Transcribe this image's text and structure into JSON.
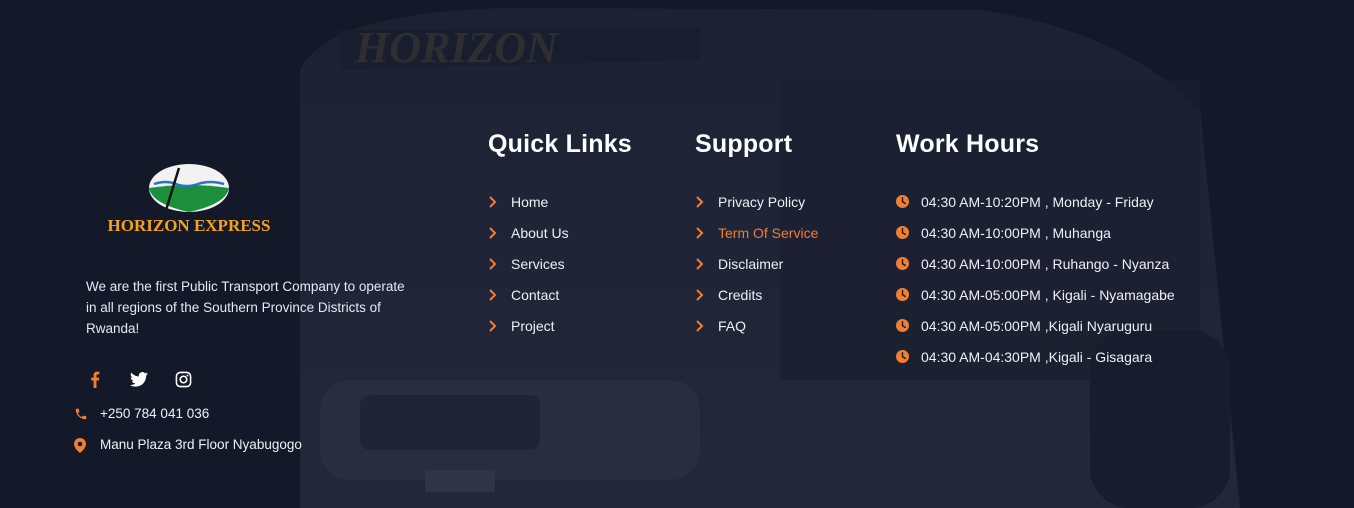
{
  "brand": {
    "logo_text": "HORIZON EXPRESS",
    "about": "We are the first Public Transport Company to operate in all regions of the Southern Province Districts of Rwanda!",
    "bus_sign": "HORIZON"
  },
  "social": [
    {
      "icon": "facebook-icon"
    },
    {
      "icon": "twitter-icon"
    },
    {
      "icon": "instagram-icon"
    }
  ],
  "contact": {
    "phone": "+250 784 041 036",
    "address": "Manu Plaza 3rd Floor Nyabugogo"
  },
  "quick_links": {
    "title": "Quick Links",
    "items": [
      "Home",
      "About Us",
      "Services",
      "Contact",
      "Project"
    ]
  },
  "support": {
    "title": "Support",
    "items": [
      "Privacy Policy",
      "Term Of Service",
      "Disclaimer",
      "Credits",
      "FAQ"
    ],
    "active_index": 1
  },
  "work_hours": {
    "title": "Work Hours",
    "items": [
      "04:30 AM-10:20PM , Monday - Friday",
      "04:30 AM-10:00PM , Muhanga",
      "04:30 AM-10:00PM , Ruhango - Nyanza",
      "04:30 AM-05:00PM , Kigali - Nyamagabe",
      "04:30 AM-05:00PM ,Kigali Nyaruguru",
      "04:30 AM-04:30PM ,Kigali - Gisagara"
    ]
  },
  "colors": {
    "accent": "#f07f2f",
    "background": "#151a2b",
    "text": "#ffffff"
  }
}
